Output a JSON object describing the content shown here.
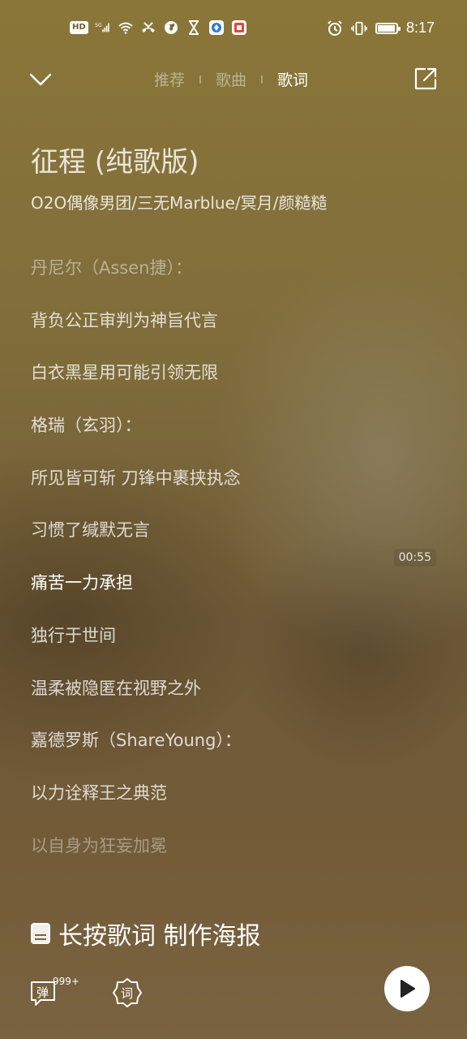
{
  "statusbar": {
    "left_icons": [
      "hd-icon",
      "5g-signal-icon",
      "wifi-icon",
      "missed-call-icon",
      "globe-icon",
      "hourglass-icon",
      "browser-app-icon",
      "red-app-icon"
    ],
    "hd_label": "HD",
    "fiveg_label": "5G",
    "battery_level": 0.95,
    "time": "8:17"
  },
  "nav": {
    "tabs": [
      {
        "label": "推荐",
        "active": false
      },
      {
        "label": "歌曲",
        "active": false
      },
      {
        "label": "歌词",
        "active": true
      }
    ]
  },
  "song": {
    "title": "征程 (纯歌版)",
    "artist": "O2O偶像男团/三无Marblue/冥月/颜糙糙"
  },
  "lyrics": [
    {
      "text": "丹尼尔（Assen捷）：",
      "state": "dim"
    },
    {
      "text": "背负公正审判为神旨代言",
      "state": "normal"
    },
    {
      "text": "白衣黑星用可能引领无限",
      "state": "normal"
    },
    {
      "text": "格瑞（玄羽）：",
      "state": "normal"
    },
    {
      "text": "所见皆可斩 刀锋中裹挟执念",
      "state": "normal"
    },
    {
      "text": "习惯了缄默无言",
      "state": "normal"
    },
    {
      "text": "痛苦一力承担",
      "state": "active"
    },
    {
      "text": "独行于世间",
      "state": "normal"
    },
    {
      "text": "温柔被隐匿在视野之外",
      "state": "normal"
    },
    {
      "text": "嘉德罗斯（ShareYoung）：",
      "state": "normal"
    },
    {
      "text": "以力诠释王之典范",
      "state": "normal"
    },
    {
      "text": "以自身为狂妄加冕",
      "state": "faded"
    }
  ],
  "timestamp": "00:55",
  "poster": {
    "label": "长按歌词 制作海报"
  },
  "bottom": {
    "danmu_label": "弹",
    "danmu_count": "999+",
    "lyric_label": "词"
  },
  "colors": {
    "background_top": "#8a7638",
    "background_bottom": "#7a6340",
    "accent": "#ffffff"
  }
}
